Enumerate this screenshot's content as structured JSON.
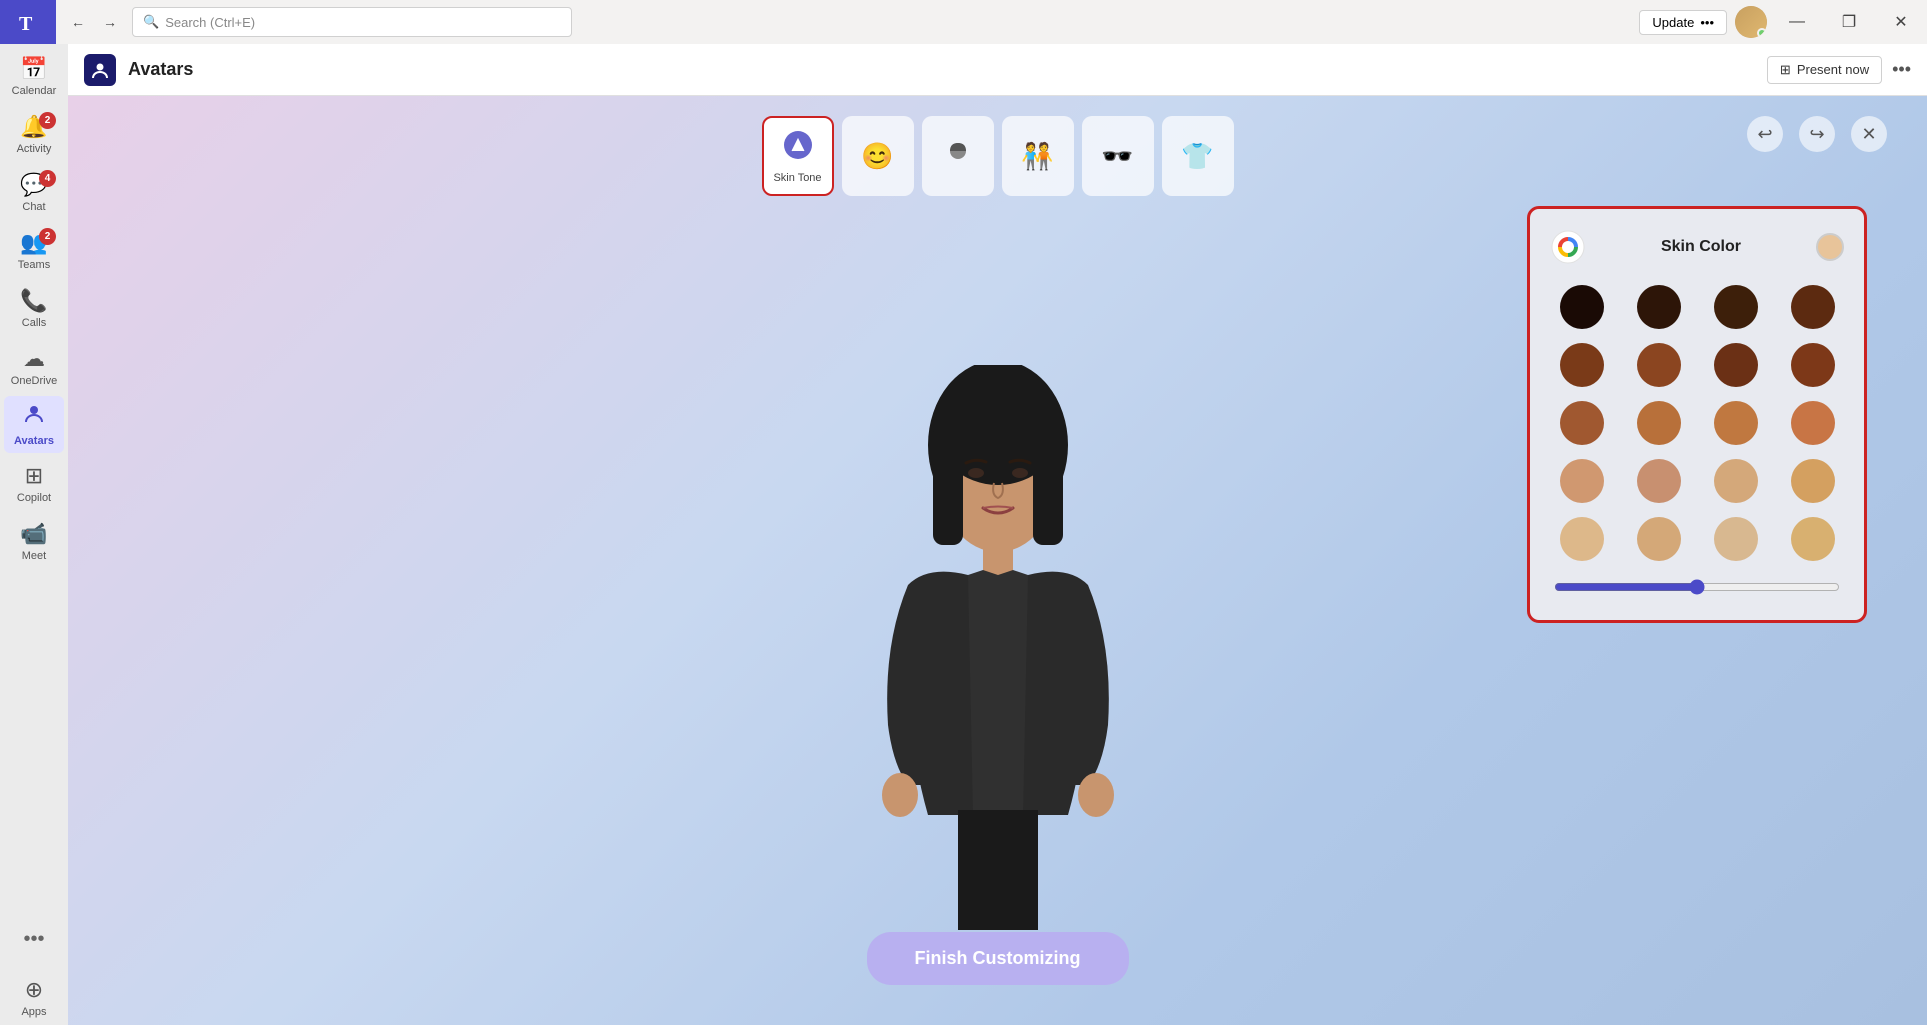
{
  "titlebar": {
    "app_name": "Microsoft Teams",
    "search_placeholder": "Search (Ctrl+E)",
    "update_label": "Update",
    "update_dots": "•••",
    "window_controls": {
      "minimize": "—",
      "maximize": "❐",
      "close": "✕"
    }
  },
  "sidebar": {
    "items": [
      {
        "id": "calendar",
        "label": "Calendar",
        "icon": "📅",
        "badge": null,
        "active": false
      },
      {
        "id": "activity",
        "label": "Activity",
        "icon": "🔔",
        "badge": "2",
        "active": false
      },
      {
        "id": "chat",
        "label": "Chat",
        "icon": "💬",
        "badge": "4",
        "active": false
      },
      {
        "id": "teams",
        "label": "Teams",
        "icon": "👥",
        "badge": "2",
        "active": false
      },
      {
        "id": "calls",
        "label": "Calls",
        "icon": "📞",
        "badge": null,
        "active": false
      },
      {
        "id": "onedrive",
        "label": "OneDrive",
        "icon": "☁",
        "badge": null,
        "active": false
      },
      {
        "id": "avatars",
        "label": "Avatars",
        "icon": "👤",
        "badge": null,
        "active": true
      },
      {
        "id": "copilot",
        "label": "Copilot",
        "icon": "⊞",
        "badge": null,
        "active": false
      },
      {
        "id": "meet",
        "label": "Meet",
        "icon": "📹",
        "badge": null,
        "active": false
      },
      {
        "id": "apps",
        "label": "Apps",
        "icon": "⊕",
        "badge": null,
        "active": false
      }
    ],
    "more_dots": "•••"
  },
  "topbar": {
    "page_title": "Avatars",
    "app_icon": "A",
    "present_now_label": "Present now",
    "present_icon": "⊞",
    "more_icon": "•••"
  },
  "customization": {
    "toolbar_items": [
      {
        "id": "skin-tone",
        "label": "Skin Tone",
        "icon": "skin",
        "active": true
      },
      {
        "id": "face",
        "label": "Face",
        "icon": "😊",
        "active": false
      },
      {
        "id": "hair",
        "label": "Hair",
        "icon": "👤",
        "active": false
      },
      {
        "id": "body",
        "label": "Body",
        "icon": "🧑‍🤝‍🧑",
        "active": false
      },
      {
        "id": "accessories",
        "label": "Accessories",
        "icon": "🕶️",
        "active": false
      },
      {
        "id": "clothing",
        "label": "Clothing",
        "icon": "👕",
        "active": false
      }
    ],
    "undo_icon": "↩",
    "redo_icon": "↪",
    "close_icon": "✕",
    "finish_label": "Finish Customizing"
  },
  "skin_panel": {
    "title": "Skin Color",
    "logo_colors": [
      "#ea4335",
      "#fbbc05",
      "#34a853",
      "#4285f4"
    ],
    "selected_color": "#e8c49a",
    "colors": [
      [
        "#1a0a05",
        "#2d1508",
        "#3d1f0a",
        "#5c2a10"
      ],
      [
        "#7a3a18",
        "#8b4520",
        "#6b3015",
        "#7d3818"
      ],
      [
        "#a05830",
        "#b8703a",
        "#c07840",
        "#c87545"
      ],
      [
        "#d09870",
        "#c89070",
        "#d4a87a",
        "#d4a060"
      ],
      [
        "#ddb88a",
        "#d4a878",
        "#d8b890",
        "#d8b070"
      ]
    ],
    "slider_value": 50
  }
}
